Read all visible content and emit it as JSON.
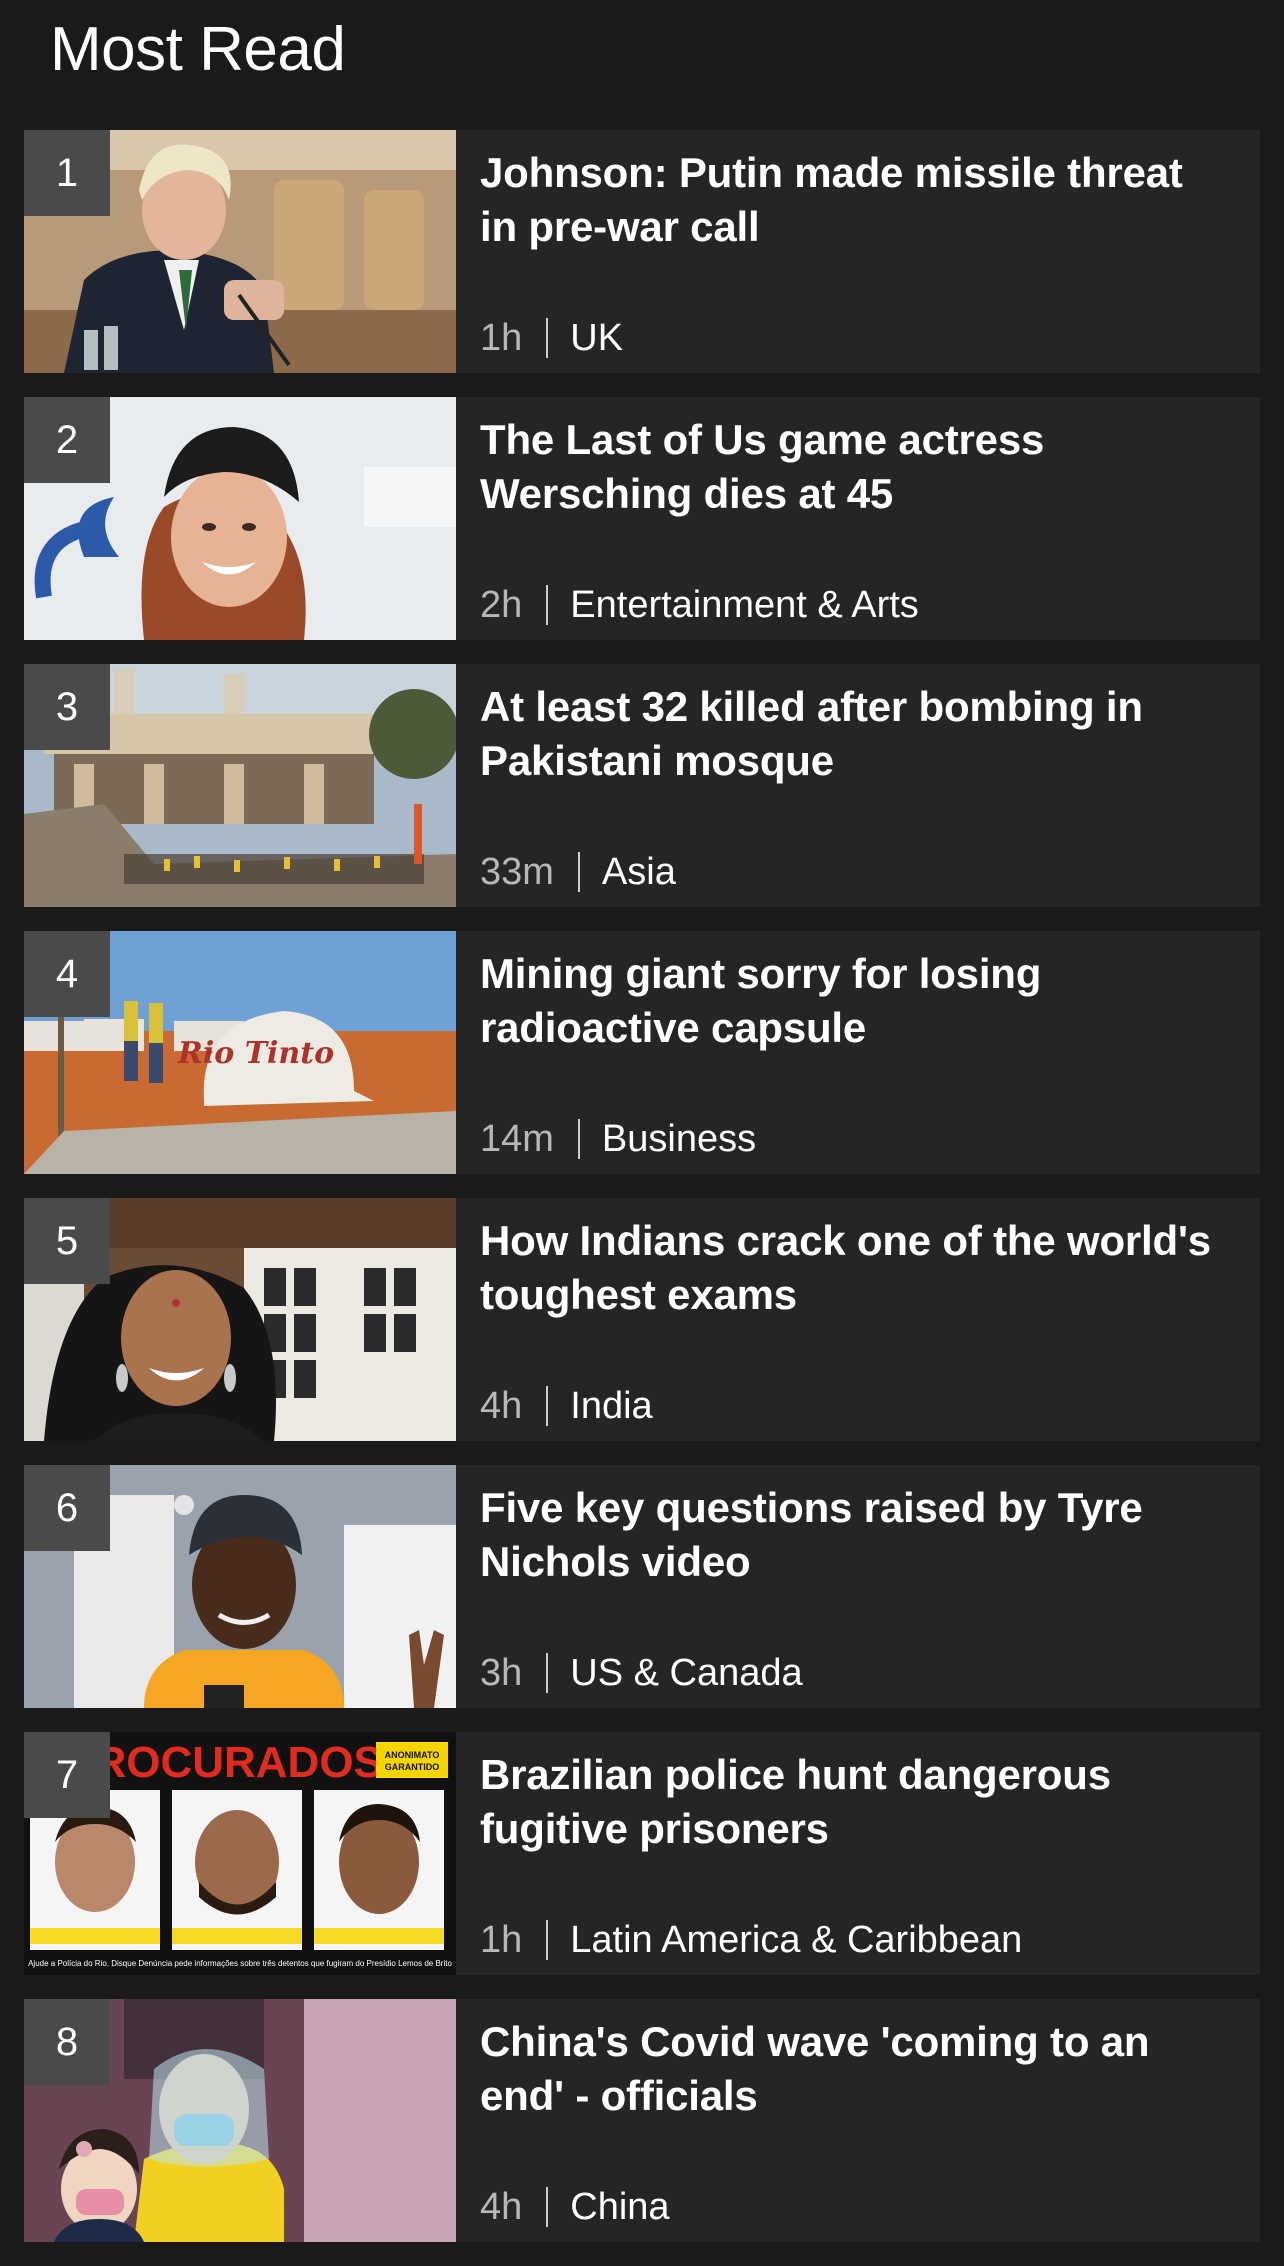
{
  "heading": "Most Read",
  "items": [
    {
      "rank": "1",
      "title": "Johnson: Putin made missile threat in pre-war call",
      "time": "1h",
      "section": "UK"
    },
    {
      "rank": "2",
      "title": "The Last of Us game actress Wersching dies at 45",
      "time": "2h",
      "section": "Entertainment & Arts"
    },
    {
      "rank": "3",
      "title": "At least 32 killed after bombing in Pakistani mosque",
      "time": "33m",
      "section": "Asia"
    },
    {
      "rank": "4",
      "title": "Mining giant sorry for losing radioactive capsule",
      "time": "14m",
      "section": "Business"
    },
    {
      "rank": "5",
      "title": "How Indians crack one of the world's toughest exams",
      "time": "4h",
      "section": "India"
    },
    {
      "rank": "6",
      "title": "Five key questions raised by Tyre Nichols video",
      "time": "3h",
      "section": "US & Canada"
    },
    {
      "rank": "7",
      "title": "Brazilian police hunt dangerous fugitive prisoners",
      "time": "1h",
      "section": "Latin America & Caribbean"
    },
    {
      "rank": "8",
      "title": "China's Covid wave 'coming to an end' - officials",
      "time": "4h",
      "section": "China"
    }
  ],
  "images": {
    "item4_helmet_text": "Rio Tinto",
    "item7_banner": "PROCURADOS",
    "item7_badge": "ANONIMATO GARANTIDO",
    "item7_footer": "Ajude a Polícia do Rio. Disque Denúncia pede informações sobre três detentos que fugiram do Presídio Lemos de Brito"
  }
}
